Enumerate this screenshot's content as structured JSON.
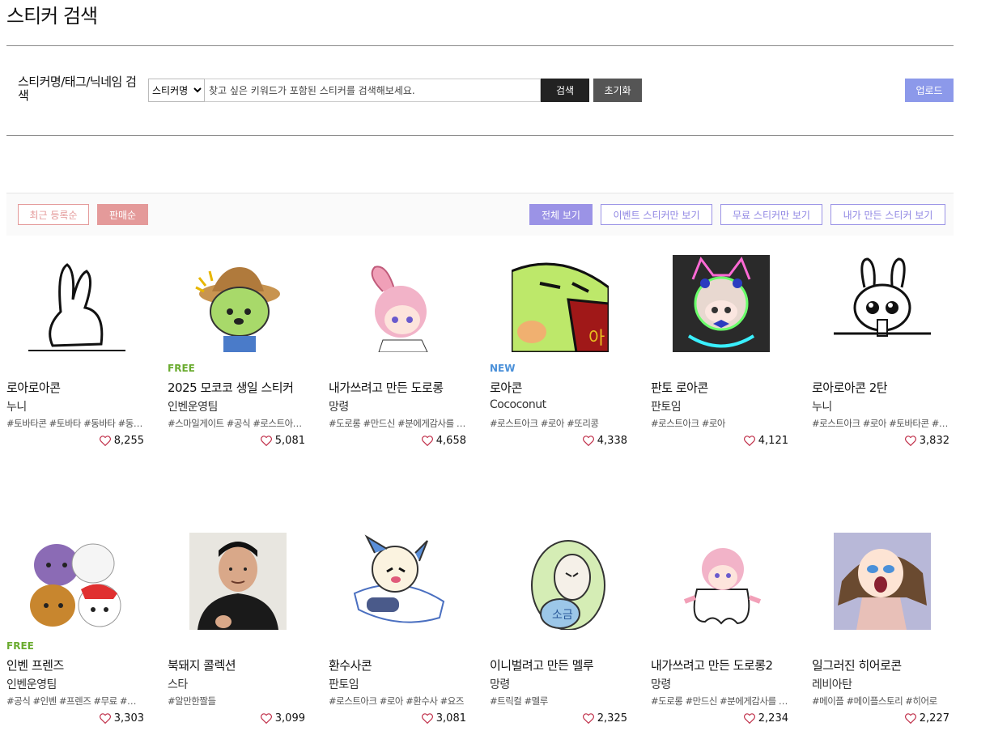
{
  "page": {
    "title": "스티커 검색"
  },
  "search": {
    "label": "스티커명/태그/닉네임 검색",
    "select_value": "스티커명",
    "placeholder": "찾고 싶은 키워드가 포함된 스티커를 검색해보세요.",
    "search_label": "검색",
    "reset_label": "초기화",
    "upload_label": "업로드"
  },
  "sort": [
    {
      "label": "최근 등록순",
      "active": false
    },
    {
      "label": "판매순",
      "active": true
    }
  ],
  "views": [
    {
      "label": "전체 보기",
      "active": true
    },
    {
      "label": "이벤트 스티커만 보기",
      "active": false
    },
    {
      "label": "무료 스티커만 보기",
      "active": false
    },
    {
      "label": "내가 만든 스티커 보기",
      "active": false
    }
  ],
  "colors": {
    "accent_purple": "#9b93e6",
    "accent_pink": "#e49a9a",
    "upload": "#8c99ea",
    "free_badge": "#6aab2f",
    "new_badge": "#4a90d9"
  },
  "stickers": [
    {
      "badge": "",
      "name": "로아로아콘",
      "author": "누니",
      "tags": "#토바타콘 #토바타 #동바타 #동…",
      "likes": "8,255",
      "icon": "white-rabbit-sticker"
    },
    {
      "badge": "FREE",
      "name": "2025 모코코 생일 스티커",
      "author": "인벤운영팀",
      "tags": "#스마일게이트 #공식 #로스트아…",
      "likes": "5,081",
      "icon": "mokoko-hat-sticker"
    },
    {
      "badge": "",
      "name": "내가쓰려고 만든 도로롱",
      "author": "망령",
      "tags": "#도로롱 #만드신 #분에게감사를 …",
      "likes": "4,658",
      "icon": "pink-hair-girl-sticker"
    },
    {
      "badge": "NEW",
      "name": "로아콘",
      "author": "Cococonut",
      "tags": "#로스트아크 #로아 #또리콩",
      "likes": "4,338",
      "icon": "green-blob-sticker"
    },
    {
      "badge": "",
      "name": "판토 로아콘",
      "author": "판토임",
      "tags": "#로스트아크 #로아",
      "likes": "4,121",
      "icon": "neon-cat-girl-sticker"
    },
    {
      "badge": "",
      "name": "로아로아콘 2탄",
      "author": "누니",
      "tags": "#로스트아크 #로아 #토바타콘 #…",
      "likes": "3,832",
      "icon": "crying-rabbit-sticker"
    },
    {
      "badge": "FREE",
      "name": "인벤 프렌즈",
      "author": "인벤운영팀",
      "tags": "#공식 #인벤 #프렌즈 #무료 #까리…",
      "likes": "3,303",
      "icon": "inven-friends-sticker"
    },
    {
      "badge": "",
      "name": "북돼지 콜렉션",
      "author": "스타",
      "tags": "#알만한짤들",
      "likes": "3,099",
      "icon": "man-portrait-sticker"
    },
    {
      "badge": "",
      "name": "환수사콘",
      "author": "판토임",
      "tags": "#로스트아크 #로아 #환수사 #요즈",
      "likes": "3,081",
      "icon": "lying-character-sticker"
    },
    {
      "badge": "",
      "name": "이니벌려고 만든 멜루",
      "author": "망령",
      "tags": "#트릭컬 #멜루",
      "likes": "2,325",
      "icon": "melon-character-sticker"
    },
    {
      "badge": "",
      "name": "내가쓰려고 만든 도로롱2",
      "author": "망령",
      "tags": "#도로롱 #만드신 #분에게감사를 …",
      "likes": "2,234",
      "icon": "ghost-girl-sticker"
    },
    {
      "badge": "",
      "name": "일그러진 히어로콘",
      "author": "레비아탄",
      "tags": "#메이플 #메이플스토리 #히어로",
      "likes": "2,227",
      "icon": "crying-girl-sticker"
    }
  ]
}
